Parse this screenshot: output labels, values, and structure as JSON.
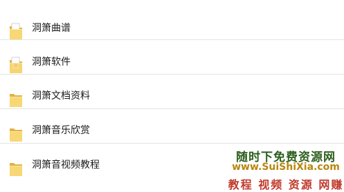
{
  "explorer": {
    "items": [
      {
        "name": "洞箫曲谱",
        "icon": "folder-with-document-icon"
      },
      {
        "name": "洞箫软件",
        "icon": "folder-with-document-icon"
      },
      {
        "name": "洞箫文档资料",
        "icon": "folder-icon"
      },
      {
        "name": "洞箫音乐欣赏",
        "icon": "folder-icon"
      },
      {
        "name": "洞箫音视频教程",
        "icon": "folder-icon"
      }
    ]
  },
  "watermark": {
    "line1": "随时下免费资源网",
    "line2": "www.SuiShiXia.com",
    "line3": "教程 视频 资源 网赚"
  },
  "colors": {
    "folder_front": "#f8d775",
    "folder_back": "#e0b341",
    "divider": "#e3e3e3",
    "watermark_green": "#2d5f1e",
    "watermark_gold": "#b8860b",
    "watermark_red": "#c0392b"
  }
}
